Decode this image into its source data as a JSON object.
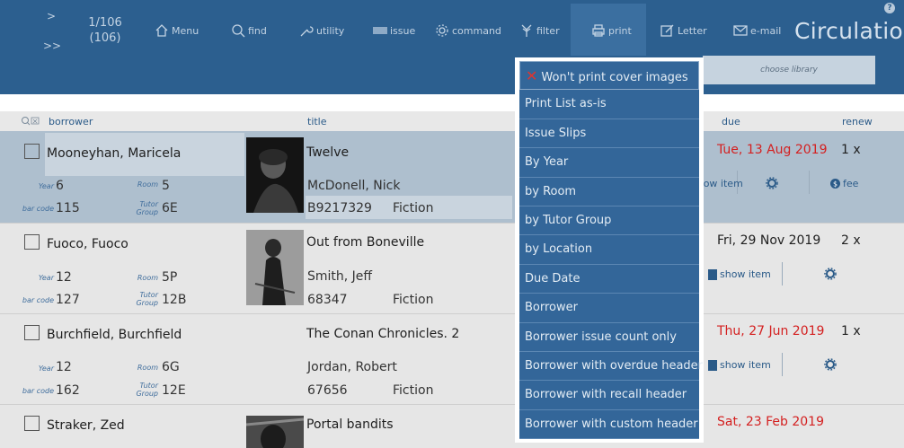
{
  "header": {
    "nav_forward": ">",
    "nav_last": ">>",
    "pager_position": "1/106",
    "pager_total": "(106)",
    "toolbar": [
      {
        "label": "Menu",
        "icon": "home-icon"
      },
      {
        "label": "find",
        "icon": "search-icon"
      },
      {
        "label": "utility",
        "icon": "wrench-icon"
      },
      {
        "label": "issue",
        "icon": "barcode-icon"
      },
      {
        "label": "command",
        "icon": "gear-icon"
      },
      {
        "label": "filter",
        "icon": "filter-icon"
      },
      {
        "label": "print",
        "icon": "printer-icon"
      },
      {
        "label": "Letter",
        "icon": "pencil-icon"
      },
      {
        "label": "e-mail",
        "icon": "envelope-icon"
      }
    ],
    "app_title": "Circulation",
    "help": "?",
    "library_placeholder": "choose library"
  },
  "columns": {
    "borrower": "borrower",
    "title": "title",
    "due": "due",
    "renew": "renew"
  },
  "print_menu": [
    "Won't print cover images",
    "Print List as-is",
    "Issue Slips",
    "By Year",
    "by Room",
    "by Tutor Group",
    "by Location",
    "Due Date",
    "Borrower",
    "Borrower issue count only",
    "Borrower with overdue header",
    "Borrower with recall header",
    "Borrower with custom header"
  ],
  "labels": {
    "year": "Year",
    "room": "Room",
    "barcode": "bar code",
    "tutor": "Tutor Group",
    "show_item": "show item",
    "fee": "fee"
  },
  "rows": [
    {
      "name": "Mooneyhan, Maricela",
      "year": "6",
      "room": "5",
      "barcode": "115",
      "tutor": "6E",
      "title": "Twelve",
      "author": "McDonell, Nick",
      "item_code": "B9217329",
      "genre": "Fiction",
      "due": "Tue, 13 Aug 2019",
      "renew": "1 x"
    },
    {
      "name": "Fuoco, Fuoco",
      "year": "12",
      "room": "5P",
      "barcode": "127",
      "tutor": "12B",
      "title": "Out from Boneville",
      "author": "Smith, Jeff",
      "item_code": "68347",
      "genre": "Fiction",
      "due": "Fri, 29 Nov 2019",
      "renew": "2 x"
    },
    {
      "name": "Burchfield, Burchfield",
      "year": "12",
      "room": "6G",
      "barcode": "162",
      "tutor": "12E",
      "title": "The Conan Chronicles. 2",
      "author": "Jordan, Robert",
      "item_code": "67656",
      "genre": "Fiction",
      "due": "Thu, 27 Jun 2019",
      "renew": "1 x"
    },
    {
      "name": "Straker, Zed",
      "title": "Portal bandits",
      "due": "Sat, 23 Feb 2019"
    }
  ],
  "colors": {
    "header_bg": "#2c5f8f",
    "menu_bg": "#336699",
    "overdue": "#d42020",
    "selected_row": "#aebfce"
  }
}
